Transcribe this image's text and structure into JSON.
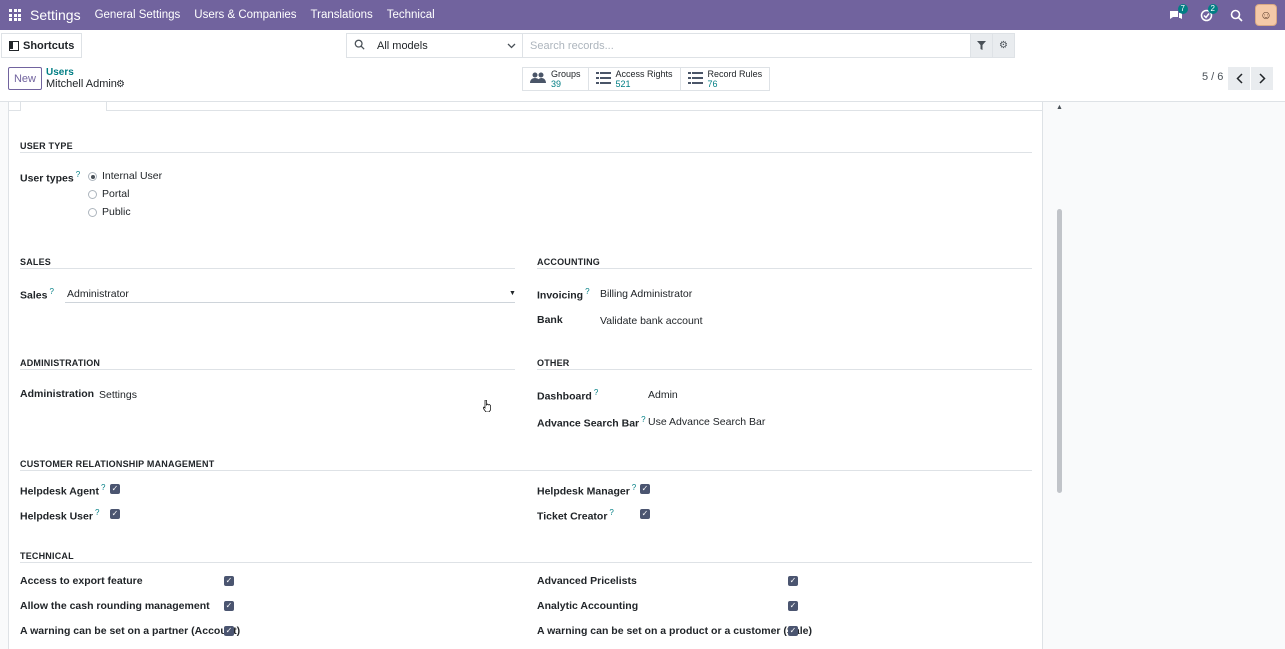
{
  "navbar": {
    "brand": "Settings",
    "menu": [
      "General Settings",
      "Users & Companies",
      "Translations",
      "Technical"
    ],
    "chat_badge": "7",
    "activity_badge": "2"
  },
  "control": {
    "shortcuts_label": "Shortcuts",
    "model_select": "All models",
    "search_placeholder": "Search records...",
    "new_label": "New",
    "breadcrumb": "Users",
    "record_name": "Mitchell Admin",
    "smart_buttons": [
      {
        "label": "Groups",
        "count": "39"
      },
      {
        "label": "Access Rights",
        "count": "521"
      },
      {
        "label": "Record Rules",
        "count": "76"
      }
    ],
    "pager": "5 / 6"
  },
  "form": {
    "user_type": {
      "title": "USER TYPE",
      "label": "User types",
      "options": [
        "Internal User",
        "Portal",
        "Public"
      ],
      "selected": "Internal User"
    },
    "sales": {
      "title": "SALES",
      "label": "Sales",
      "value": "Administrator"
    },
    "accounting": {
      "title": "ACCOUNTING",
      "invoicing_label": "Invoicing",
      "invoicing_value": "Billing Administrator",
      "bank_label": "Bank",
      "bank_value": "Validate bank account"
    },
    "administration": {
      "title": "ADMINISTRATION",
      "label": "Administration",
      "value": "Settings"
    },
    "other": {
      "title": "OTHER",
      "dashboard_label": "Dashboard",
      "dashboard_value": "Admin",
      "search_label": "Advance Search Bar",
      "search_value": "Use Advance Search Bar"
    },
    "crm": {
      "title": "CUSTOMER RELATIONSHIP MANAGEMENT",
      "helpdesk_agent": "Helpdesk Agent",
      "helpdesk_user": "Helpdesk User",
      "helpdesk_manager": "Helpdesk Manager",
      "ticket_creator": "Ticket Creator"
    },
    "technical": {
      "title": "TECHNICAL",
      "left": [
        "Access to export feature",
        "Allow the cash rounding management",
        "A warning can be set on a partner (Account)"
      ],
      "right": [
        "Advanced Pricelists",
        "Analytic Accounting",
        "A warning can be set on a product or a customer (Sale)"
      ]
    }
  },
  "colors": {
    "navbar": "#71639e",
    "accent": "#017e84",
    "checkbox": "#4b5570"
  }
}
